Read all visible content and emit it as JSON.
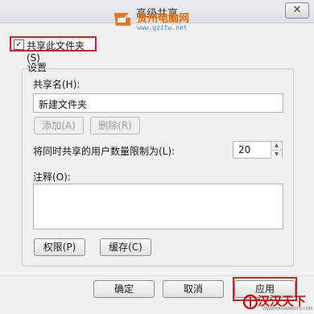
{
  "dialog": {
    "title": "高级共享",
    "close_glyph": "✕"
  },
  "watermark": {
    "site_name": "贵州电脑网",
    "site_url": "www.gzitw.net"
  },
  "share_folder": {
    "checked": true,
    "check_glyph": "✓",
    "label": "共享此文件夹(S)"
  },
  "settings": {
    "group_title": "设置",
    "share_name_label": "共享名(H):",
    "share_name_value": "新建文件夹",
    "add_button": "添加(A)",
    "remove_button": "删除(R)",
    "limit_label": "将同时共享的用户数量限制为(L):",
    "limit_value": "20",
    "comment_label": "注释(O):",
    "comment_value": "",
    "permissions_button": "权限(P)",
    "caching_button": "缓存(C)"
  },
  "footer": {
    "ok_button": "确定",
    "cancel_button": "取消",
    "apply_button": "应用"
  },
  "brand": {
    "name": "汉汉天下",
    "sub": "WWW.HANWANGTX.COM"
  },
  "colors": {
    "highlight": "#d91e1e",
    "watermark_orange": "#e66a0a",
    "watermark_blue": "#3b8bd4"
  }
}
